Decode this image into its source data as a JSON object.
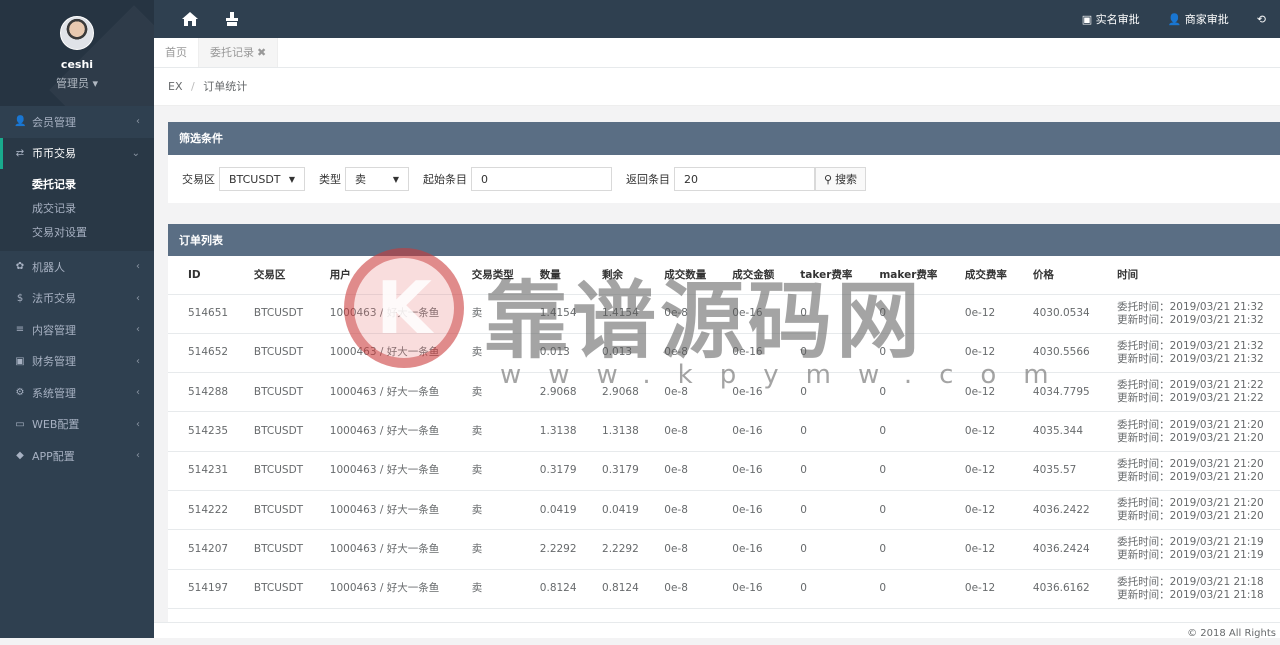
{
  "profile": {
    "name": "ceshi",
    "role": "管理员 ▾"
  },
  "menu": [
    {
      "label": "会员管理",
      "icon": "user-icon",
      "glyph": "👤"
    },
    {
      "label": "币币交易",
      "icon": "exchange-icon",
      "glyph": "⇄",
      "active": true
    },
    {
      "label": "机器人",
      "icon": "paw-icon",
      "glyph": "✿"
    },
    {
      "label": "法币交易",
      "icon": "dollar-icon",
      "glyph": "$"
    },
    {
      "label": "内容管理",
      "icon": "list-icon",
      "glyph": "≡"
    },
    {
      "label": "财务管理",
      "icon": "money-icon",
      "glyph": "▣"
    },
    {
      "label": "系统管理",
      "icon": "gears-icon",
      "glyph": "⚙"
    },
    {
      "label": "WEB配置",
      "icon": "laptop-icon",
      "glyph": "▭"
    },
    {
      "label": "APP配置",
      "icon": "android-icon",
      "glyph": "◆"
    }
  ],
  "submenu": [
    "委托记录",
    "成交记录",
    "交易对设置"
  ],
  "topbar": {
    "realname": "实名审批",
    "merchant": "商家审批"
  },
  "tabs": {
    "home": "首页",
    "current": "委托记录",
    "close": "✖"
  },
  "breadcrumb": {
    "root": "EX",
    "sep": "/",
    "page": "订单统计"
  },
  "filter": {
    "title": "筛选条件",
    "market_label": "交易区",
    "market_value": "BTCUSDT",
    "type_label": "类型",
    "type_value": "卖",
    "start_label": "起始条目",
    "start_value": "0",
    "count_label": "返回条目",
    "count_value": "20",
    "search": "搜索"
  },
  "orders": {
    "title": "订单列表",
    "columns": [
      "ID",
      "交易区",
      "用户",
      "交易类型",
      "数量",
      "剩余",
      "成交数量",
      "成交金额",
      "taker费率",
      "maker费率",
      "成交费率",
      "价格",
      "时间"
    ],
    "rows": [
      [
        "514651",
        "BTCUSDT",
        "1000463 / 好大一条鱼",
        "卖",
        "1.4154",
        "1.4154",
        "0e-8",
        "0e-16",
        "0",
        "0",
        "0e-12",
        "4030.0534",
        "委托时间：2019/03/21 21:32",
        "更新时间：2019/03/21 21:32"
      ],
      [
        "514652",
        "BTCUSDT",
        "1000463 / 好大一条鱼",
        "卖",
        "0.013",
        "0.013",
        "0e-8",
        "0e-16",
        "0",
        "0",
        "0e-12",
        "4030.5566",
        "委托时间：2019/03/21 21:32",
        "更新时间：2019/03/21 21:32"
      ],
      [
        "514288",
        "BTCUSDT",
        "1000463 / 好大一条鱼",
        "卖",
        "2.9068",
        "2.9068",
        "0e-8",
        "0e-16",
        "0",
        "0",
        "0e-12",
        "4034.7795",
        "委托时间：2019/03/21 21:22",
        "更新时间：2019/03/21 21:22"
      ],
      [
        "514235",
        "BTCUSDT",
        "1000463 / 好大一条鱼",
        "卖",
        "1.3138",
        "1.3138",
        "0e-8",
        "0e-16",
        "0",
        "0",
        "0e-12",
        "4035.344",
        "委托时间：2019/03/21 21:20",
        "更新时间：2019/03/21 21:20"
      ],
      [
        "514231",
        "BTCUSDT",
        "1000463 / 好大一条鱼",
        "卖",
        "0.3179",
        "0.3179",
        "0e-8",
        "0e-16",
        "0",
        "0",
        "0e-12",
        "4035.57",
        "委托时间：2019/03/21 21:20",
        "更新时间：2019/03/21 21:20"
      ],
      [
        "514222",
        "BTCUSDT",
        "1000463 / 好大一条鱼",
        "卖",
        "0.0419",
        "0.0419",
        "0e-8",
        "0e-16",
        "0",
        "0",
        "0e-12",
        "4036.2422",
        "委托时间：2019/03/21 21:20",
        "更新时间：2019/03/21 21:20"
      ],
      [
        "514207",
        "BTCUSDT",
        "1000463 / 好大一条鱼",
        "卖",
        "2.2292",
        "2.2292",
        "0e-8",
        "0e-16",
        "0",
        "0",
        "0e-12",
        "4036.2424",
        "委托时间：2019/03/21 21:19",
        "更新时间：2019/03/21 21:19"
      ],
      [
        "514197",
        "BTCUSDT",
        "1000463 / 好大一条鱼",
        "卖",
        "0.8124",
        "0.8124",
        "0e-8",
        "0e-16",
        "0",
        "0",
        "0e-12",
        "4036.6162",
        "委托时间：2019/03/21 21:18",
        "更新时间：2019/03/21 21:18"
      ],
      [
        "",
        "",
        "",
        "",
        "",
        "",
        "",
        "",
        "",
        "",
        "",
        "",
        "委托时间：2019/03/21 21:18",
        ""
      ]
    ]
  },
  "footer": "© 2018 All Rights",
  "watermark": {
    "letter": "K",
    "text": "靠谱源码网",
    "url": "www.kpymw.com"
  }
}
